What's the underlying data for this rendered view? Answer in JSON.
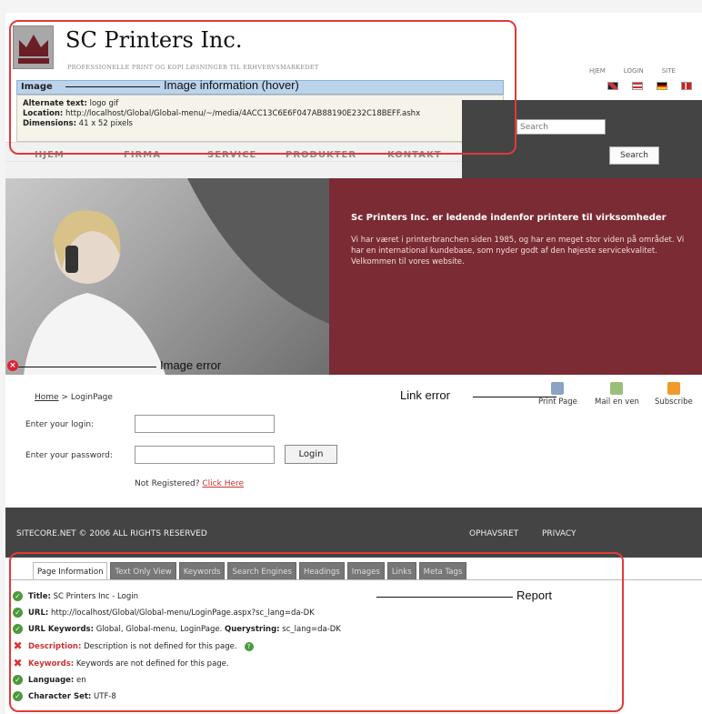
{
  "header": {
    "brand_name": "SC Printers Inc.",
    "brand_tagline": "PROFESSIONELLE PRINT OG KOPI LØSNINGER TIL ERHVERVSMARKEDET",
    "top_links": [
      "HJEM",
      "LOGIN",
      "SITE"
    ]
  },
  "tooltip": {
    "title": "Image",
    "alt_label": "Alternate text:",
    "alt_value": "logo gif",
    "location_label": "Location:",
    "location_value": "http://localhost/Global/Global-menu/~/media/4ACC13C6E6F047AB88190E232C18BEFF.ashx",
    "dimensions_label": "Dimensions:",
    "dimensions_value": "41 x 52 pixels"
  },
  "nav": {
    "items": [
      "HJEM",
      "FIRMA",
      "SERVICE",
      "PRODUKTER",
      "KONTAKT"
    ]
  },
  "search": {
    "placeholder": "Search",
    "button": "Search"
  },
  "hero": {
    "heading": "Sc Printers Inc. er ledende indenfor printere til virksomheder",
    "body": "Vi har været i printerbranchen siden 1985, og har en meget stor viden på området. Vi har en international kundebase, som nyder godt af den højeste servicekvalitet. Velkommen til vores website."
  },
  "login": {
    "breadcrumb_home": "Home",
    "breadcrumb_current": "> LoginPage",
    "login_label": "Enter your login:",
    "password_label": "Enter your password:",
    "login_button": "Login",
    "not_registered": "Not Registered?",
    "click_here": "Click Here"
  },
  "tools": {
    "print": "Print Page",
    "mail": "Mail en ven",
    "subscribe": "Subscribe"
  },
  "footer": {
    "copyright": "SITECORE.NET © 2006 ALL RIGHTS RESERVED",
    "link1": "OPHAVSRET",
    "link2": "PRIVACY"
  },
  "report": {
    "tabs": [
      "Page Information",
      "Text Only View",
      "Keywords",
      "Search Engines",
      "Headings",
      "Images",
      "Links",
      "Meta Tags"
    ],
    "title_label": "Title:",
    "title_value": "SC Printers Inc - Login",
    "url_label": "URL:",
    "url_value": "http://localhost/Global/Global-menu/LoginPage.aspx?sc_lang=da-DK",
    "urlkw_label": "URL Keywords:",
    "urlkw_value": "Global, Global-menu, LoginPage.",
    "qs_label": "Querystring:",
    "qs_value": "sc_lang=da-DK",
    "desc_label": "Description:",
    "desc_value": "Description is not defined for this page.",
    "kw_label": "Keywords:",
    "kw_value": "Keywords are not defined for this page.",
    "lang_label": "Language:",
    "lang_value": "en",
    "charset_label": "Character Set:",
    "charset_value": "UTF-8"
  },
  "annotations": {
    "image_info": "Image information (hover)",
    "image_error": "Image error",
    "link_error": "Link error",
    "report": "Report"
  },
  "colors": {
    "hero_red": "#7b2b33",
    "dark_gray": "#444444",
    "annotation_red": "#e03a3a",
    "ok_green": "#4a9a3a"
  }
}
